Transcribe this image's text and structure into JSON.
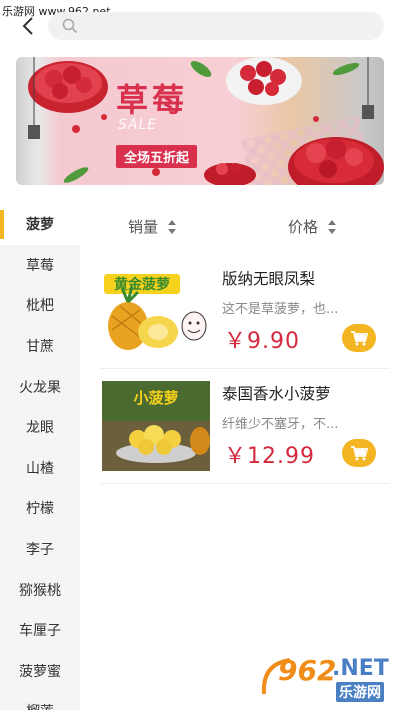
{
  "watermark_top": "乐游网 www.962.net",
  "header": {
    "search_placeholder": ""
  },
  "banner": {
    "title": "草莓",
    "subtitle": "SALE",
    "promo": "全场五折起"
  },
  "sort": {
    "sales_label": "销量",
    "price_label": "价格"
  },
  "categories": [
    "菠萝",
    "草莓",
    "枇杷",
    "甘蔗",
    "火龙果",
    "龙眼",
    "山楂",
    "柠檬",
    "李子",
    "猕猴桃",
    "车厘子",
    "菠萝蜜",
    "榴莲"
  ],
  "active_category": "菠萝",
  "products": [
    {
      "name": "版纳无眼凤梨",
      "desc": "这不是草菠萝，也...",
      "price": "￥9.90",
      "thumb_label": "黄金菠萝"
    },
    {
      "name": "泰国香水小菠萝",
      "desc": "纤维少不塞牙，不...",
      "price": "￥12.99",
      "thumb_label": "小菠萝"
    }
  ],
  "watermark": {
    "number": "962",
    "domain": ".NET",
    "site": "乐游网"
  },
  "colors": {
    "accent": "#f4b522",
    "price": "#d4293e",
    "banner_red": "#d9304d"
  }
}
